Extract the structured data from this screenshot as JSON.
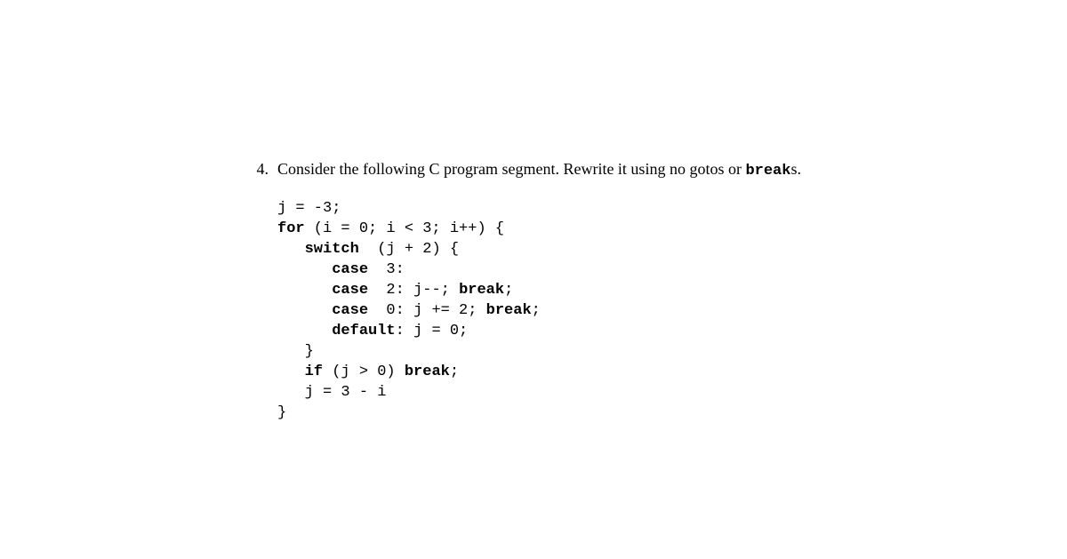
{
  "problem": {
    "number": "4.",
    "prompt_a": "Consider the following C program segment. Rewrite it using no gotos or ",
    "prompt_kw": "break",
    "prompt_b": "s.",
    "code": {
      "l1a": "j = -3;",
      "l2kw": "for",
      "l2a": " (i = 0; i < 3; i++) {",
      "l3kw": "switch",
      "l3a": "  (j + 2) {",
      "l4kw": "case",
      "l4a": "  3:",
      "l5kw": "case",
      "l5a": "  2: j--; ",
      "l5kw2": "break",
      "l5b": ";",
      "l6kw": "case",
      "l6a": "  0: j += 2; ",
      "l6kw2": "break",
      "l6b": ";",
      "l7kw": "default",
      "l7a": ": j = 0;",
      "l8a": "   }",
      "l9kw": "if",
      "l9a": " (j > 0) ",
      "l9kw2": "break",
      "l9b": ";",
      "l10a": "   j = 3 - i",
      "l11a": "}"
    }
  }
}
